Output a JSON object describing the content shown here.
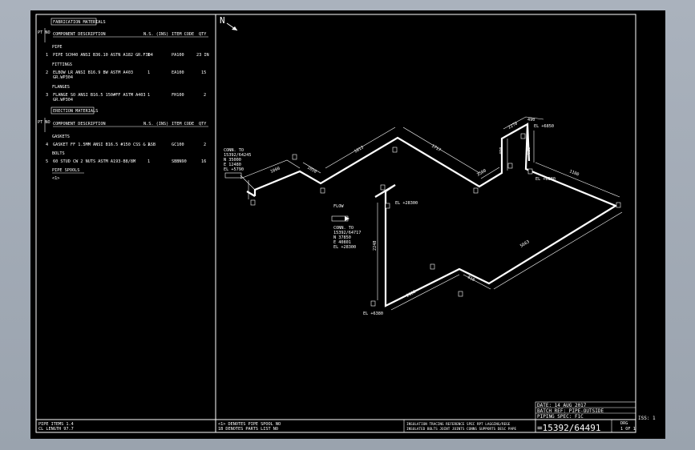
{
  "fab": {
    "title": "FABRICATION MATERIALS",
    "pt_no": "PT NO",
    "hdr_desc": "COMPONENT DESCRIPTION",
    "hdr_ns": "N.S. (INS)",
    "hdr_code": "ITEM CODE",
    "hdr_qty": "QTY",
    "sections": [
      {
        "name": "PIPE",
        "rows": [
          {
            "no": "1",
            "desc": "PIPE SCH40 ANSI B36.10 ASTN A182 GR.F304",
            "desc2": "",
            "ns": "1",
            "code": "PA100",
            "qty": "23 IN"
          }
        ]
      },
      {
        "name": "FITTINGS",
        "rows": [
          {
            "no": "2",
            "desc": "ELBOW LR ANSI B16.9 BW ASTM A403",
            "desc2": "GR.WP304",
            "ns": "1",
            "code": "EA100",
            "qty": "15"
          }
        ]
      },
      {
        "name": "FLANGES",
        "rows": [
          {
            "no": "3",
            "desc": "FLANGE SO ANSI B16.5 150#FF ASTM A403",
            "desc2": "GR.WP304",
            "ns": "1",
            "code": "FH100",
            "qty": "2"
          }
        ]
      }
    ]
  },
  "erec": {
    "title": "ERECTION MATERIALS",
    "pt_no": "PT NO",
    "hdr_desc": "COMPONENT DESCRIPTION",
    "hdr_ns": "N.S. (INS)",
    "hdr_code": "ITEM CODE",
    "hdr_qty": "QTY",
    "sections": [
      {
        "name": "GASKETS",
        "rows": [
          {
            "no": "4",
            "desc": "GASKET FF 1.5MM ANSI B16.5 #150 CSS & ASB",
            "ns": "1",
            "code": "GC100",
            "qty": "2"
          }
        ]
      },
      {
        "name": "BOLTS",
        "rows": [
          {
            "no": "5",
            "desc": "60 STUD CW 2 NUTS ASTM A193-B8/8M",
            "ns": "1",
            "code": "SBBN90",
            "qty": "16"
          }
        ]
      }
    ],
    "spools_label": "PIPE SPOOLS",
    "spools_value": "<1>"
  },
  "north": "N",
  "iso": {
    "dims": [
      "1000",
      "1050",
      "1013",
      "1717",
      "3500",
      "2270",
      "490",
      "625",
      "1100",
      "5663",
      "810",
      "2100",
      "2248",
      "490"
    ],
    "conn1": {
      "lines": [
        "CONN. TO",
        "15392/64245",
        "N 35000",
        "E 12480",
        "EL +5790"
      ]
    },
    "conn2": {
      "lines": [
        "CONN. TO",
        "15392/64717",
        "N 37850",
        "E 40801",
        "EL +28300"
      ]
    },
    "flow": "FLOW",
    "elevations": [
      "EL +6850",
      "EL +6380",
      "EL +28300",
      "EL +6380"
    ]
  },
  "footer": {
    "pipe_items": "PIPE ITEMS  1.4",
    "cl_length": "CL LENGTH  97.7",
    "note1": "<1> DENOTES PIPE SPOOL NO",
    "note2": "1B DENOTES PARTS LIST NO",
    "headers1": "INSULATION  TRACING  REFERENCE  SPEC  RPT  LAGGING/REGE",
    "headers2": "INSULATED  BOLTS  JOINT  JOINTS  CONNS  SUPPORTS  DESC  PAPE",
    "date": "DATE: 14 AUG 2017",
    "batch": "BATCH REF: PIPE-OUTSIDE",
    "piping_spec": "PIPING SPEC: F1C",
    "drawing_no": "=15392/64491",
    "drg_label": "DRG",
    "drg_of": "1 OF 1",
    "iss": "ISS: 1"
  }
}
